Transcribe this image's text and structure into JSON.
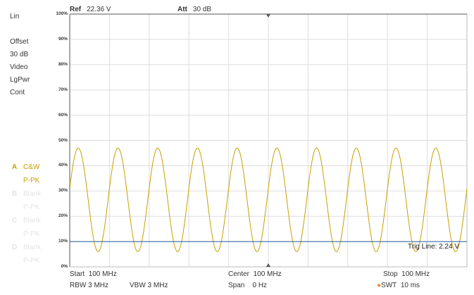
{
  "side": {
    "scale": "Lin",
    "offset_label": "Offset",
    "offset_value": "30 dB",
    "detector_type": "Video",
    "average": "LgPwr",
    "sweep_mode": "Cont"
  },
  "traces": [
    {
      "letter": "A",
      "name": "C&W",
      "mode": "P-PK",
      "active": true
    },
    {
      "letter": "B",
      "name": "Blank",
      "mode": "P-PK",
      "active": false
    },
    {
      "letter": "C",
      "name": "Blank",
      "mode": "P-PK",
      "active": false
    },
    {
      "letter": "D",
      "name": "Blank",
      "mode": "P-PK",
      "active": false
    }
  ],
  "header": {
    "ref_label": "Ref",
    "ref_value": "22.36 V",
    "att_label": "Att",
    "att_value": "30 dB"
  },
  "y_ticks": [
    "100%",
    "90%",
    "80%",
    "70%",
    "60%",
    "50%",
    "40%",
    "30%",
    "20%",
    "10%",
    "0%"
  ],
  "trigger": {
    "label": "Trig Line: 2.24 V",
    "level_percent": 10
  },
  "footer": {
    "start": "Start",
    "start_value": "100 MHz",
    "center": "Center",
    "center_value": "100 MHz",
    "stop": "Stop",
    "stop_value": "100 MHz",
    "rbw": "RBW 3 MHz",
    "vbw": "VBW 3 MHz",
    "span": "Span",
    "span_value": "0 Hz",
    "swt": "SWT",
    "swt_value": "10 ms"
  },
  "signal": {
    "cycles": 10,
    "max_percent": 47,
    "min_percent": 6,
    "start_percent": 31
  },
  "colors": {
    "trace": "#c8a000",
    "trig": "#2a5a9a",
    "grid": "#dddddd",
    "swt_dot": "#ff8c3a"
  }
}
